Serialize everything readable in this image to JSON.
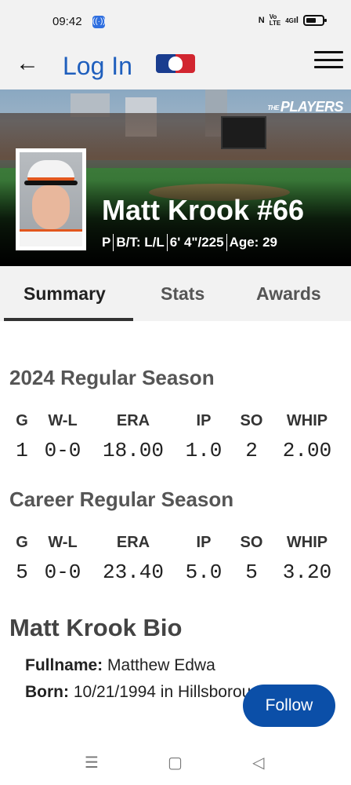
{
  "status_bar": {
    "time": "09:42",
    "network": "4G",
    "icons": [
      "cast-icon",
      "nfc-icon",
      "volte-icon",
      "signal-icon",
      "battery-icon"
    ]
  },
  "nav": {
    "title": "Log In",
    "icons": [
      "back-arrow-icon",
      "mlb-logo",
      "hamburger-menu-icon"
    ]
  },
  "hero": {
    "brand": "PLAYERS",
    "brand_prefix": "THE",
    "player_name": "Matt Krook #66",
    "position": "P",
    "bats_throws": "B/T: L/L",
    "height_weight": "6' 4\"/225",
    "age": "Age: 29"
  },
  "tabs": {
    "summary": "Summary",
    "stats": "Stats",
    "awards": "Awards",
    "selected": "Summary"
  },
  "season_2024": {
    "title": "2024 Regular Season",
    "headers": [
      "G",
      "W-L",
      "ERA",
      "IP",
      "SO",
      "WHIP"
    ],
    "values": [
      "1",
      "0-0",
      "18.00",
      "1.0",
      "2",
      "2.00"
    ]
  },
  "career": {
    "title": "Career Regular Season",
    "headers": [
      "G",
      "W-L",
      "ERA",
      "IP",
      "SO",
      "WHIP"
    ],
    "values": [
      "5",
      "0-0",
      "23.40",
      "5.0",
      "5",
      "3.20"
    ]
  },
  "bio": {
    "title": "Matt Krook Bio",
    "fullname_label": "Fullname:",
    "fullname_value": "Matthew Edwa",
    "born_label": "Born:",
    "born_value": "10/21/1994 in Hillsborough,"
  },
  "follow_button": "Follow",
  "system_nav": {
    "icons": [
      "recents-icon",
      "home-icon",
      "back-triangle-icon"
    ]
  },
  "colors": {
    "accent": "#1f5fbd",
    "follow": "#0b4fa8",
    "orioles_orange": "#e2571e"
  }
}
